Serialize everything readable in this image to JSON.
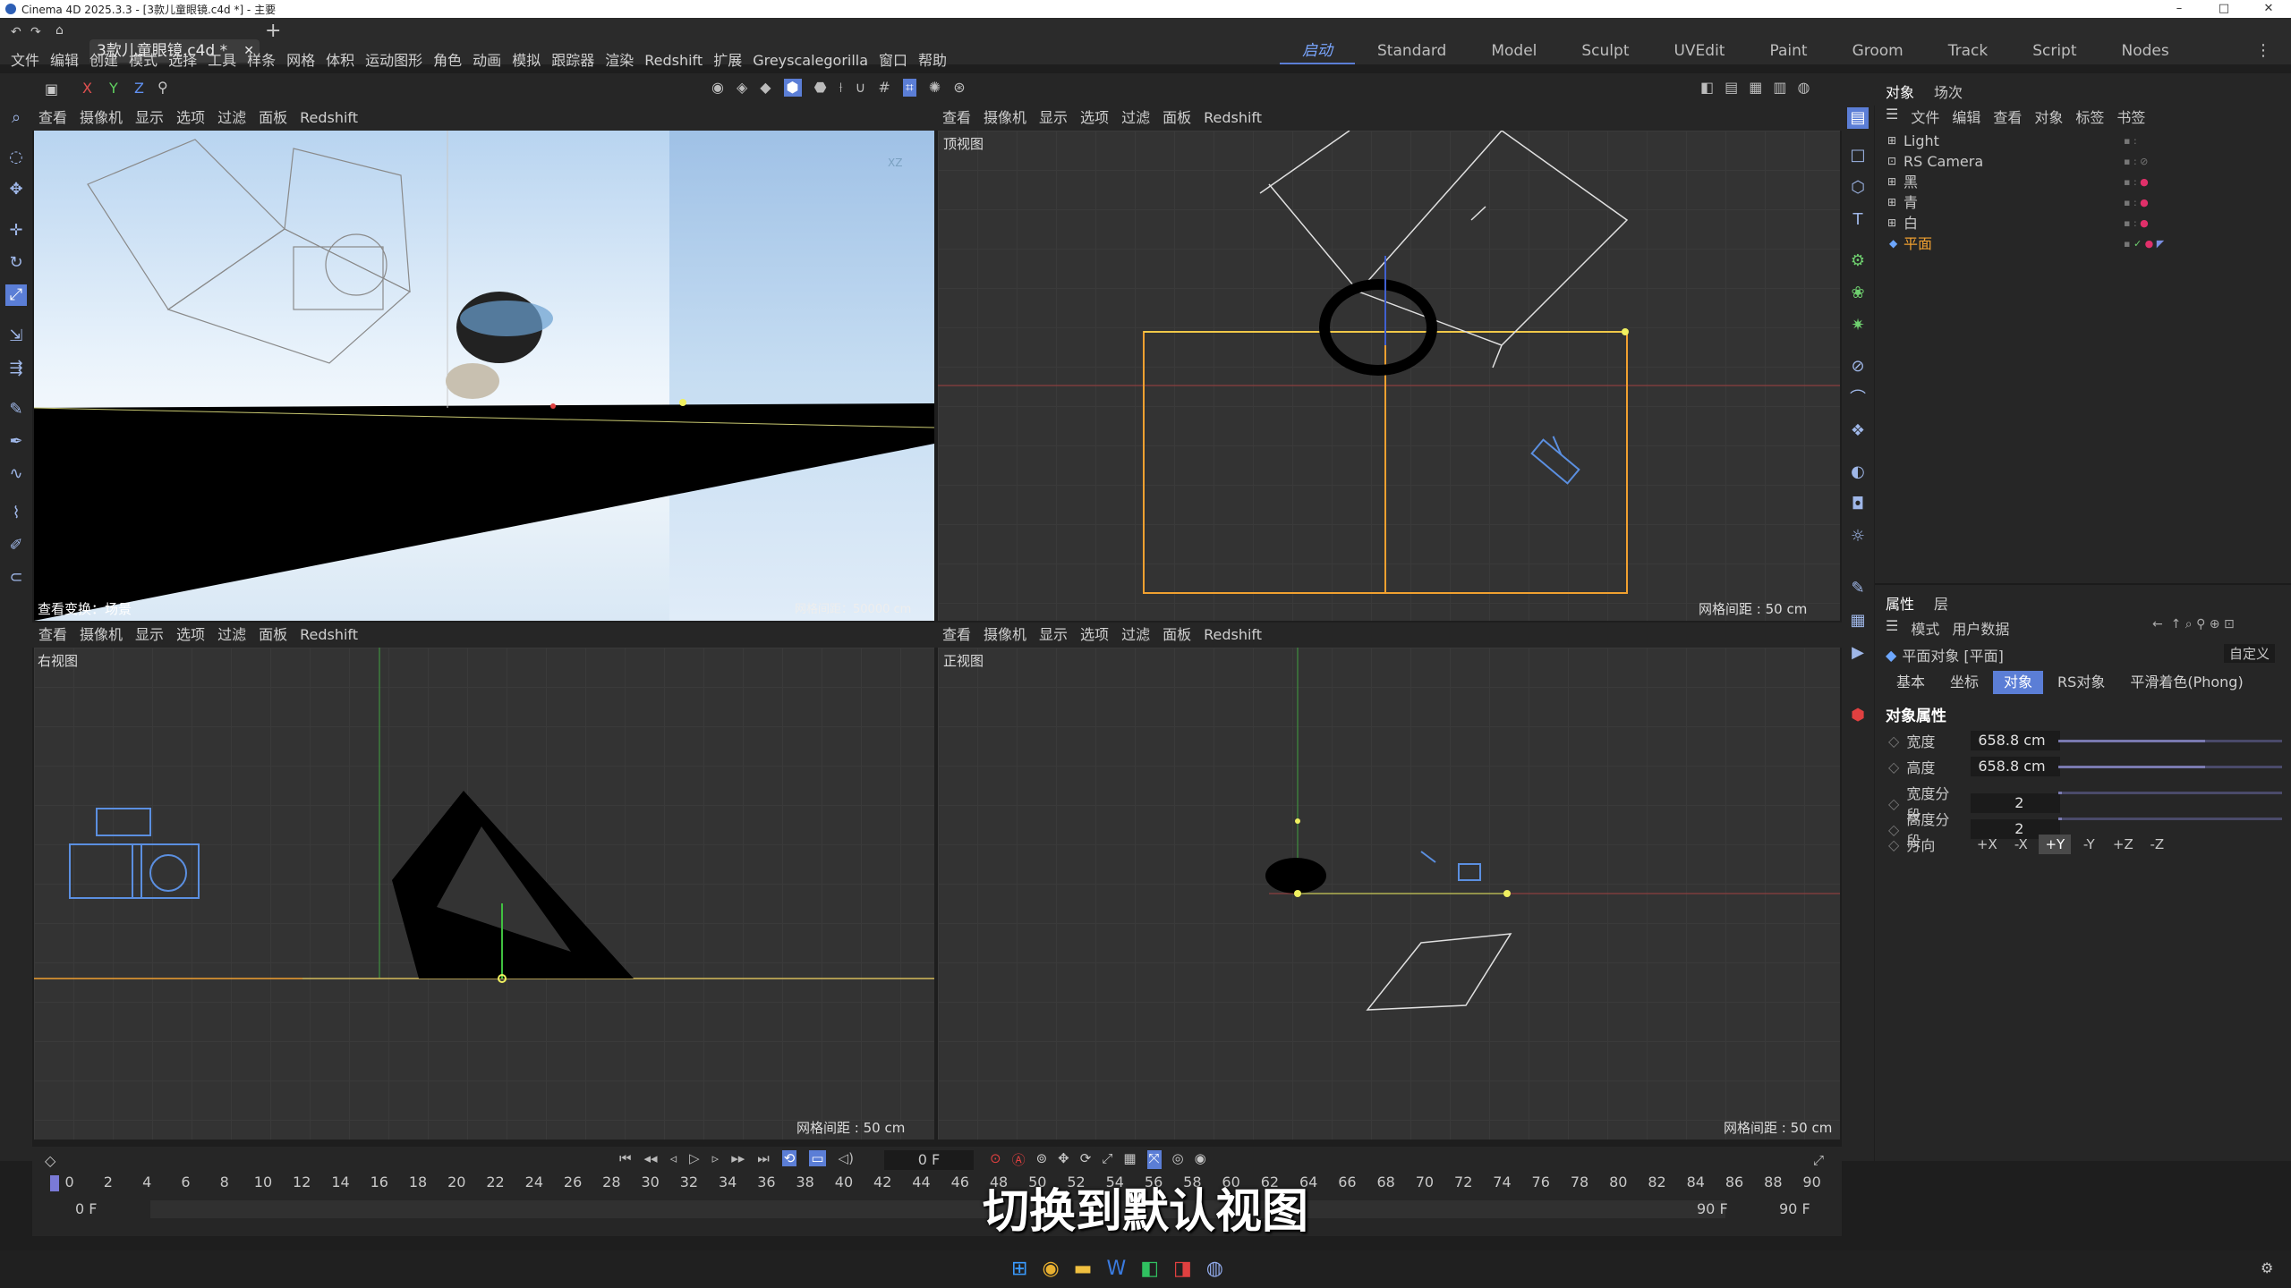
{
  "window": {
    "title": "Cinema 4D 2025.3.3 - [3款儿童眼镜.c4d *] - 主要",
    "minimize": "–",
    "maximize": "□",
    "close": "✕"
  },
  "doc_tab": {
    "label": "3款儿童眼镜.c4d *",
    "close": "✕",
    "add": "+"
  },
  "layouts": [
    "启动",
    "Standard",
    "Model",
    "Sculpt",
    "UVEdit",
    "Paint",
    "Groom",
    "Track",
    "Script",
    "Nodes"
  ],
  "menu": [
    "文件",
    "编辑",
    "创建",
    "模式",
    "选择",
    "工具",
    "样条",
    "网格",
    "体积",
    "运动图形",
    "角色",
    "动画",
    "模拟",
    "跟踪器",
    "渲染",
    "Redshift",
    "扩展",
    "Greyscalegorilla",
    "窗口",
    "帮助"
  ],
  "toolbar_axes": [
    "X",
    "Y",
    "Z"
  ],
  "viewport_menu": [
    "查看",
    "摄像机",
    "显示",
    "选项",
    "过滤",
    "面板",
    "Redshift"
  ],
  "viewports": {
    "perspective": {
      "bottom_label": "查看变换：场景",
      "grid_note": "网格间距：50000 cm"
    },
    "top": {
      "name": "顶视图",
      "grid_spacing": "网格间距 : 50 cm"
    },
    "right": {
      "name": "右视图",
      "grid_spacing": "网格间距 : 50 cm"
    },
    "front": {
      "name": "正视图",
      "grid_spacing": "网格间距 : 50 cm"
    }
  },
  "object_panel": {
    "tabs": [
      "对象",
      "场次"
    ],
    "menu": [
      "文件",
      "编辑",
      "查看",
      "对象",
      "标签",
      "书签"
    ],
    "objects": [
      {
        "name": "Light",
        "color": "#c8c8c8"
      },
      {
        "name": "RS Camera",
        "color": "#c8c8c8"
      },
      {
        "name": "黑",
        "color": "#c8c8c8"
      },
      {
        "name": "青",
        "color": "#c8c8c8"
      },
      {
        "name": "白",
        "color": "#c8c8c8"
      },
      {
        "name": "平面",
        "color": "#f0a030"
      }
    ]
  },
  "attributes": {
    "tabs": [
      "属性",
      "层"
    ],
    "menu": [
      "模式",
      "用户数据"
    ],
    "object_title": "平面对象 [平面]",
    "preset": "自定义",
    "sub_tabs": [
      "基本",
      "坐标",
      "对象",
      "RS对象",
      "平滑着色(Phong)"
    ],
    "active_sub_tab": "对象",
    "section": "对象属性",
    "width_label": "宽度",
    "width": "658.8 cm",
    "height_label": "高度",
    "height": "658.8 cm",
    "wseg_label": "宽度分段",
    "wseg": "2",
    "hseg_label": "高度分段",
    "hseg": "2",
    "dir_label": "方向",
    "directions": [
      "+X",
      "-X",
      "+Y",
      "-Y",
      "+Z",
      "-Z"
    ],
    "active_direction": "+Y"
  },
  "timeline": {
    "current_frame": "0 F",
    "ticks": [
      "0",
      "2",
      "4",
      "6",
      "8",
      "10",
      "12",
      "14",
      "16",
      "18",
      "20",
      "22",
      "24",
      "26",
      "28",
      "30",
      "32",
      "34",
      "36",
      "38",
      "40",
      "42",
      "44",
      "46",
      "48",
      "50",
      "52",
      "54",
      "56",
      "58",
      "60",
      "62",
      "64",
      "66",
      "68",
      "70",
      "72",
      "74",
      "76",
      "78",
      "80",
      "82",
      "84",
      "86",
      "88",
      "90"
    ],
    "start_a": "0 F",
    "start_b": "0 F",
    "end_a": "90 F",
    "end_b": "90 F"
  },
  "subtitle": "切换到默认视图",
  "colors": {
    "accent": "#5b7ed6",
    "axis_x": "#d04040",
    "axis_y": "#40c040",
    "selection": "#f0a030"
  }
}
